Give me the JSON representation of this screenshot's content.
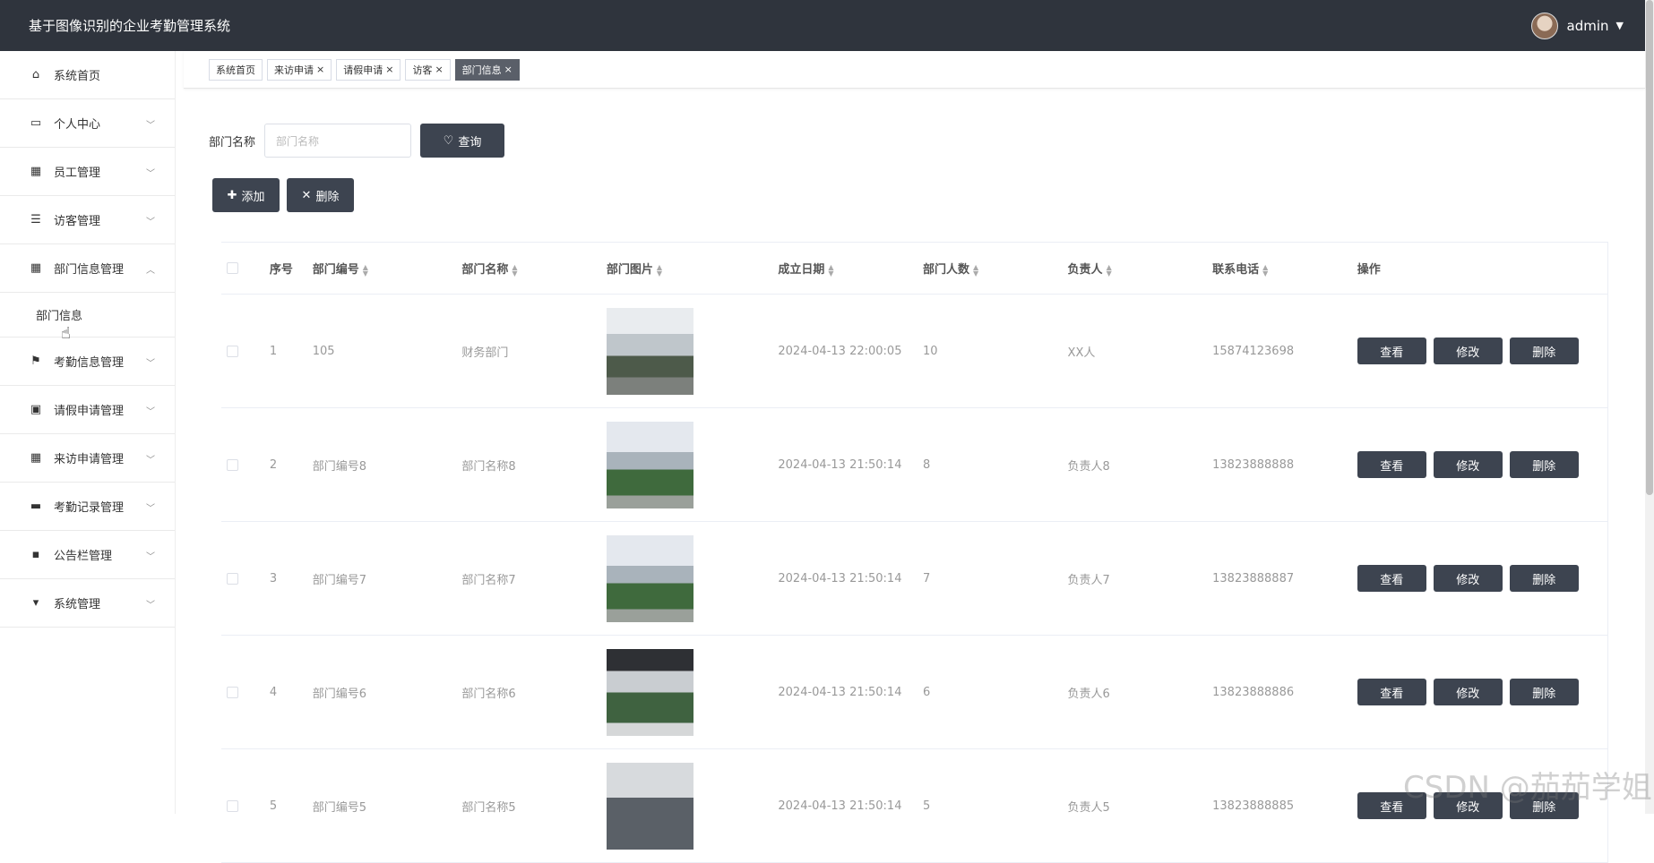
{
  "header": {
    "title": "基于图像识别的企业考勤管理系统",
    "username": "admin"
  },
  "sidebar": {
    "items": [
      {
        "label": "系统首页",
        "icon": "home-icon",
        "expandable": false
      },
      {
        "label": "个人中心",
        "icon": "card-icon",
        "expandable": true
      },
      {
        "label": "员工管理",
        "icon": "grid-icon",
        "expandable": true
      },
      {
        "label": "访客管理",
        "icon": "list-icon",
        "expandable": true
      },
      {
        "label": "部门信息管理",
        "icon": "grid-icon",
        "expandable": true,
        "expanded": true,
        "sub": "部门信息"
      },
      {
        "label": "考勤信息管理",
        "icon": "flag-icon",
        "expandable": true
      },
      {
        "label": "请假申请管理",
        "icon": "clipboard-icon",
        "expandable": true
      },
      {
        "label": "来访申请管理",
        "icon": "grid-icon",
        "expandable": true
      },
      {
        "label": "考勤记录管理",
        "icon": "briefcase-icon",
        "expandable": true
      },
      {
        "label": "公告栏管理",
        "icon": "message-icon",
        "expandable": true
      },
      {
        "label": "系统管理",
        "icon": "brush-icon",
        "expandable": true
      }
    ]
  },
  "tabs": [
    {
      "label": "系统首页",
      "closable": false,
      "active": false
    },
    {
      "label": "来访申请",
      "closable": true,
      "active": false
    },
    {
      "label": "请假申请",
      "closable": true,
      "active": false
    },
    {
      "label": "访客",
      "closable": true,
      "active": false
    },
    {
      "label": "部门信息",
      "closable": true,
      "active": true
    }
  ],
  "search": {
    "label": "部门名称",
    "placeholder": "部门名称",
    "button": "查询"
  },
  "actions": {
    "add": "添加",
    "delete": "删除"
  },
  "table": {
    "headers": [
      "序号",
      "部门编号",
      "部门名称",
      "部门图片",
      "成立日期",
      "部门人数",
      "负责人",
      "联系电话",
      "操作"
    ],
    "rows": [
      {
        "idx": "1",
        "code": "105",
        "name": "财务部门",
        "date": "2024-04-13 22:00:05",
        "count": "10",
        "leader": "XX人",
        "phone": "15874123698"
      },
      {
        "idx": "2",
        "code": "部门编号8",
        "name": "部门名称8",
        "date": "2024-04-13 21:50:14",
        "count": "8",
        "leader": "负责人8",
        "phone": "13823888888"
      },
      {
        "idx": "3",
        "code": "部门编号7",
        "name": "部门名称7",
        "date": "2024-04-13 21:50:14",
        "count": "7",
        "leader": "负责人7",
        "phone": "13823888887"
      },
      {
        "idx": "4",
        "code": "部门编号6",
        "name": "部门名称6",
        "date": "2024-04-13 21:50:14",
        "count": "6",
        "leader": "负责人6",
        "phone": "13823888886"
      },
      {
        "idx": "5",
        "code": "部门编号5",
        "name": "部门名称5",
        "date": "2024-04-13 21:50:14",
        "count": "5",
        "leader": "负责人5",
        "phone": "13823888885"
      }
    ],
    "ops": {
      "view": "查看",
      "edit": "修改",
      "delete": "删除"
    }
  },
  "watermark": "CSDN @茄茄学姐"
}
